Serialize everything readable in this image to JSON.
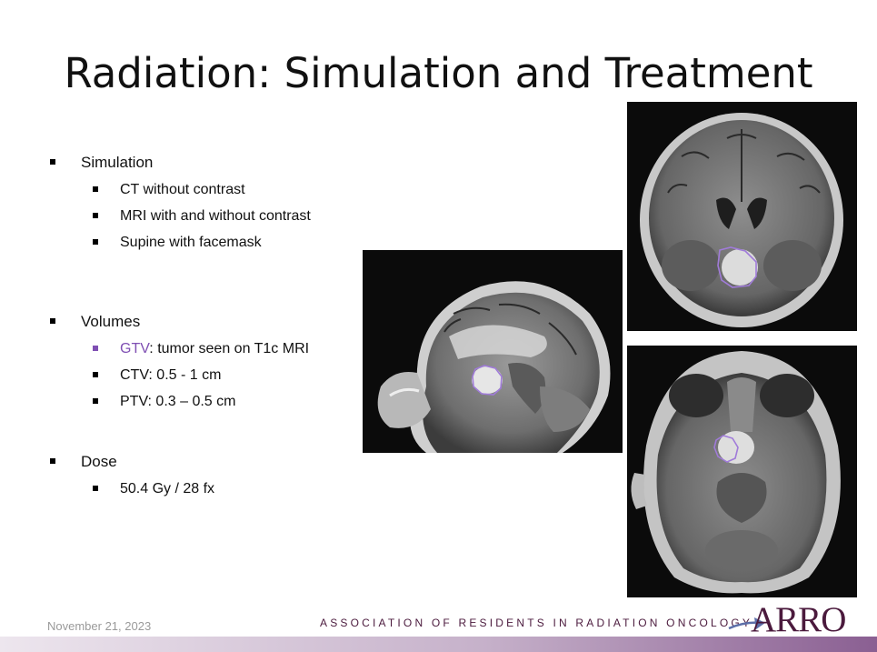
{
  "slide": {
    "title": "Radiation: Simulation and Treatment",
    "sections": [
      {
        "label": "Simulation",
        "items": [
          "CT without contrast",
          "MRI with and without contrast",
          "Supine with facemask"
        ]
      },
      {
        "label": "Volumes",
        "gtv_label": "GTV",
        "gtv_rest": ": tumor seen on T1c MRI",
        "items": [
          "CTV: 0.5 - 1 cm",
          "PTV: 0.3 – 0.5 cm"
        ]
      },
      {
        "label": "Dose",
        "items": [
          "50.4 Gy / 28 fx"
        ]
      }
    ]
  },
  "footer": {
    "date": "November 21, 2023",
    "organization": "ASSOCIATION OF RESIDENTS IN RADIATION ONCOLOGY",
    "logo_text": "ARRO"
  },
  "colors": {
    "gtv_purple": "#7f4fb3",
    "brand_plum": "#4b1a3d"
  },
  "images": {
    "sagittal": "mri-sagittal-image",
    "coronal": "mri-coronal-image",
    "axial": "mri-axial-image"
  }
}
